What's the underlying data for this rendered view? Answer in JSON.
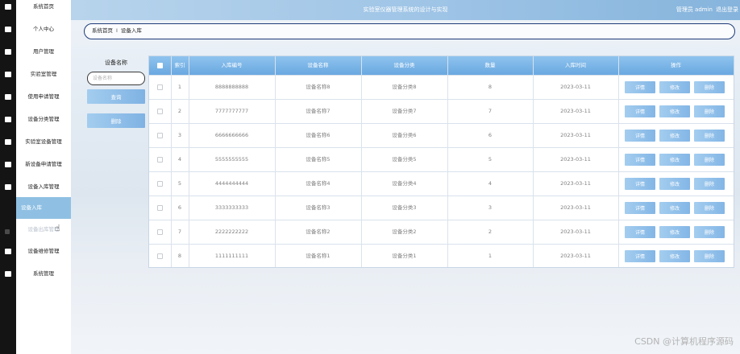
{
  "header": {
    "title": "实验室仪器管理系统的设计与实现",
    "admin": "管理员 admin",
    "logout": "退出登录"
  },
  "sidebar": {
    "items": [
      {
        "label": "系统首页"
      },
      {
        "label": "个人中心"
      },
      {
        "label": "用户管理"
      },
      {
        "label": "实验室管理"
      },
      {
        "label": "使用申请管理"
      },
      {
        "label": "设备分类管理"
      },
      {
        "label": "实验室设备管理"
      },
      {
        "label": "新设备申请管理"
      },
      {
        "label": "设备入库管理"
      },
      {
        "label": "设备入库"
      },
      {
        "label": "设备出库管理"
      },
      {
        "label": "设备维修管理"
      },
      {
        "label": "系统管理"
      }
    ]
  },
  "breadcrumb": {
    "home": "系统首页",
    "separator": "I",
    "current": "设备入库"
  },
  "search": {
    "label": "设备名称",
    "placeholder": "设备名称",
    "query_button": "查询",
    "delete_button": "删除"
  },
  "table": {
    "headers": [
      "索引",
      "入库编号",
      "设备名称",
      "设备分类",
      "数量",
      "入库时间",
      "操作"
    ],
    "actions": {
      "detail": "详情",
      "edit": "修改",
      "delete": "删除"
    },
    "rows": [
      {
        "index": "1",
        "code": "8888888888",
        "name": "设备名称8",
        "category": "设备分类8",
        "qty": "8",
        "date": "2023-03-11"
      },
      {
        "index": "2",
        "code": "7777777777",
        "name": "设备名称7",
        "category": "设备分类7",
        "qty": "7",
        "date": "2023-03-11"
      },
      {
        "index": "3",
        "code": "6666666666",
        "name": "设备名称6",
        "category": "设备分类6",
        "qty": "6",
        "date": "2023-03-11"
      },
      {
        "index": "4",
        "code": "5555555555",
        "name": "设备名称5",
        "category": "设备分类5",
        "qty": "5",
        "date": "2023-03-11"
      },
      {
        "index": "5",
        "code": "4444444444",
        "name": "设备名称4",
        "category": "设备分类4",
        "qty": "4",
        "date": "2023-03-11"
      },
      {
        "index": "6",
        "code": "3333333333",
        "name": "设备名称3",
        "category": "设备分类3",
        "qty": "3",
        "date": "2023-03-11"
      },
      {
        "index": "7",
        "code": "2222222222",
        "name": "设备名称2",
        "category": "设备分类2",
        "qty": "2",
        "date": "2023-03-11"
      },
      {
        "index": "8",
        "code": "1111111111",
        "name": "设备名称1",
        "category": "设备分类1",
        "qty": "1",
        "date": "2023-03-11"
      }
    ]
  },
  "watermark": "CSDN @计算机程序源码",
  "colors": {
    "accent": "#8ec3ee",
    "active_nav": "#8fc0e3",
    "icon_strip": "#141414"
  }
}
